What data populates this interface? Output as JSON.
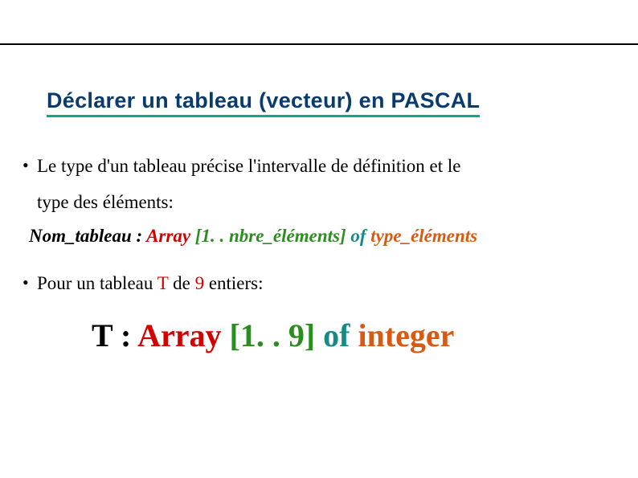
{
  "title": "Déclarer un  tableau (vecteur) en PASCAL",
  "bullet1": {
    "line1": "Le type d'un tableau précise l'intervalle de définition et le",
    "line2": "type des éléments:"
  },
  "syntax": {
    "name": "Nom_tableau",
    "colon": " : ",
    "array": "Array",
    "bracket": " [1. . nbre_éléments] ",
    "of": "of",
    "space": " ",
    "type": "type_éléments"
  },
  "bullet2": {
    "a": "Pour un tableau ",
    "t": "T",
    "mid": " de ",
    "nine": "9",
    "end": " entiers:"
  },
  "example": {
    "t": "T",
    "colon": " : ",
    "array": "Array",
    "bracket": " [1. . 9] ",
    "of": "of",
    "space": " ",
    "type": "integer"
  }
}
